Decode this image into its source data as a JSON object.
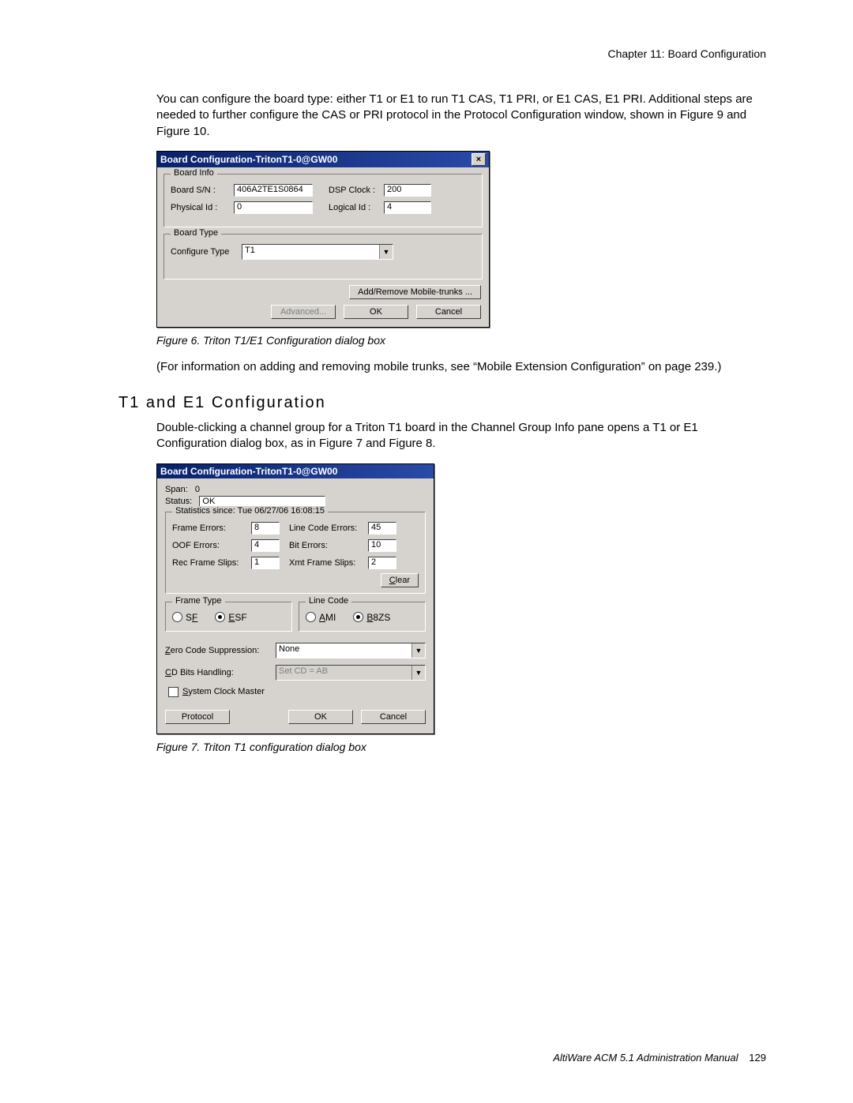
{
  "header": "Chapter 11:  Board Configuration",
  "intro": "You can configure the board type: either T1 or E1 to run T1 CAS, T1 PRI, or E1 CAS, E1 PRI. Additional steps are needed to further configure the CAS or PRI protocol in the Protocol Configuration window, shown in Figure 9 and Figure 10.",
  "dialog1": {
    "title": "Board Configuration-TritonT1-0@GW00",
    "board_info_legend": "Board Info",
    "board_sn_label": "Board S/N :",
    "board_sn_value": "406A2TE1S0864",
    "dsp_clock_label": "DSP Clock :",
    "dsp_clock_value": "200",
    "physical_id_label": "Physical Id :",
    "physical_id_value": "0",
    "logical_id_label": "Logical Id :",
    "logical_id_value": "4",
    "board_type_legend": "Board Type",
    "configure_type_label": "Configure Type",
    "configure_type_value": "T1",
    "add_remove_btn": "Add/Remove Mobile-trunks ...",
    "advanced_btn": "Advanced...",
    "ok_btn": "OK",
    "cancel_btn": "Cancel"
  },
  "figure6_caption": "Figure 6.   Triton T1/E1 Configuration dialog box",
  "mobile_note": "(For information on adding and removing mobile trunks, see “Mobile Extension Configuration” on page 239.)",
  "section_heading": "T1 and E1 Configuration",
  "section_body": "Double-clicking a channel group for a Triton T1 board in the Channel Group Info pane opens a T1 or E1 Configuration dialog box, as in Figure 7 and Figure 8.",
  "dialog2": {
    "title": "Board Configuration-TritonT1-0@GW00",
    "span_label": "Span:",
    "span_value": "0",
    "status_label": "Status:",
    "status_value": "OK",
    "stats_legend": "Statistics since: Tue 06/27/06 16:08:15",
    "frame_errors_label": "Frame Errors:",
    "frame_errors_value": "8",
    "line_code_errors_label": "Line Code Errors:",
    "line_code_errors_value": "45",
    "oof_errors_label": "OOF Errors:",
    "oof_errors_value": "4",
    "bit_errors_label": "Bit Errors:",
    "bit_errors_value": "10",
    "rec_frame_slips_label": "Rec Frame Slips:",
    "rec_frame_slips_value": "1",
    "xmt_frame_slips_label": "Xmt Frame Slips:",
    "xmt_frame_slips_value": "2",
    "clear_btn": "Clear",
    "frame_type_legend": "Frame Type",
    "radio_sf": "SF",
    "radio_esf": "ESF",
    "line_code_legend": "Line Code",
    "radio_ami": "AMI",
    "radio_b8zs": "B8ZS",
    "zero_code_label": "Zero Code Suppression:",
    "zero_code_value": "None",
    "cd_bits_label": "CD Bits Handling:",
    "cd_bits_value": "Set CD = AB",
    "system_clock_label": "System Clock Master",
    "protocol_btn": "Protocol",
    "ok_btn": "OK",
    "cancel_btn": "Cancel"
  },
  "figure7_caption": "Figure 7.   Triton T1 configuration dialog box",
  "footer_text": "AltiWare ACM 5.1 Administration Manual",
  "footer_page": "129"
}
